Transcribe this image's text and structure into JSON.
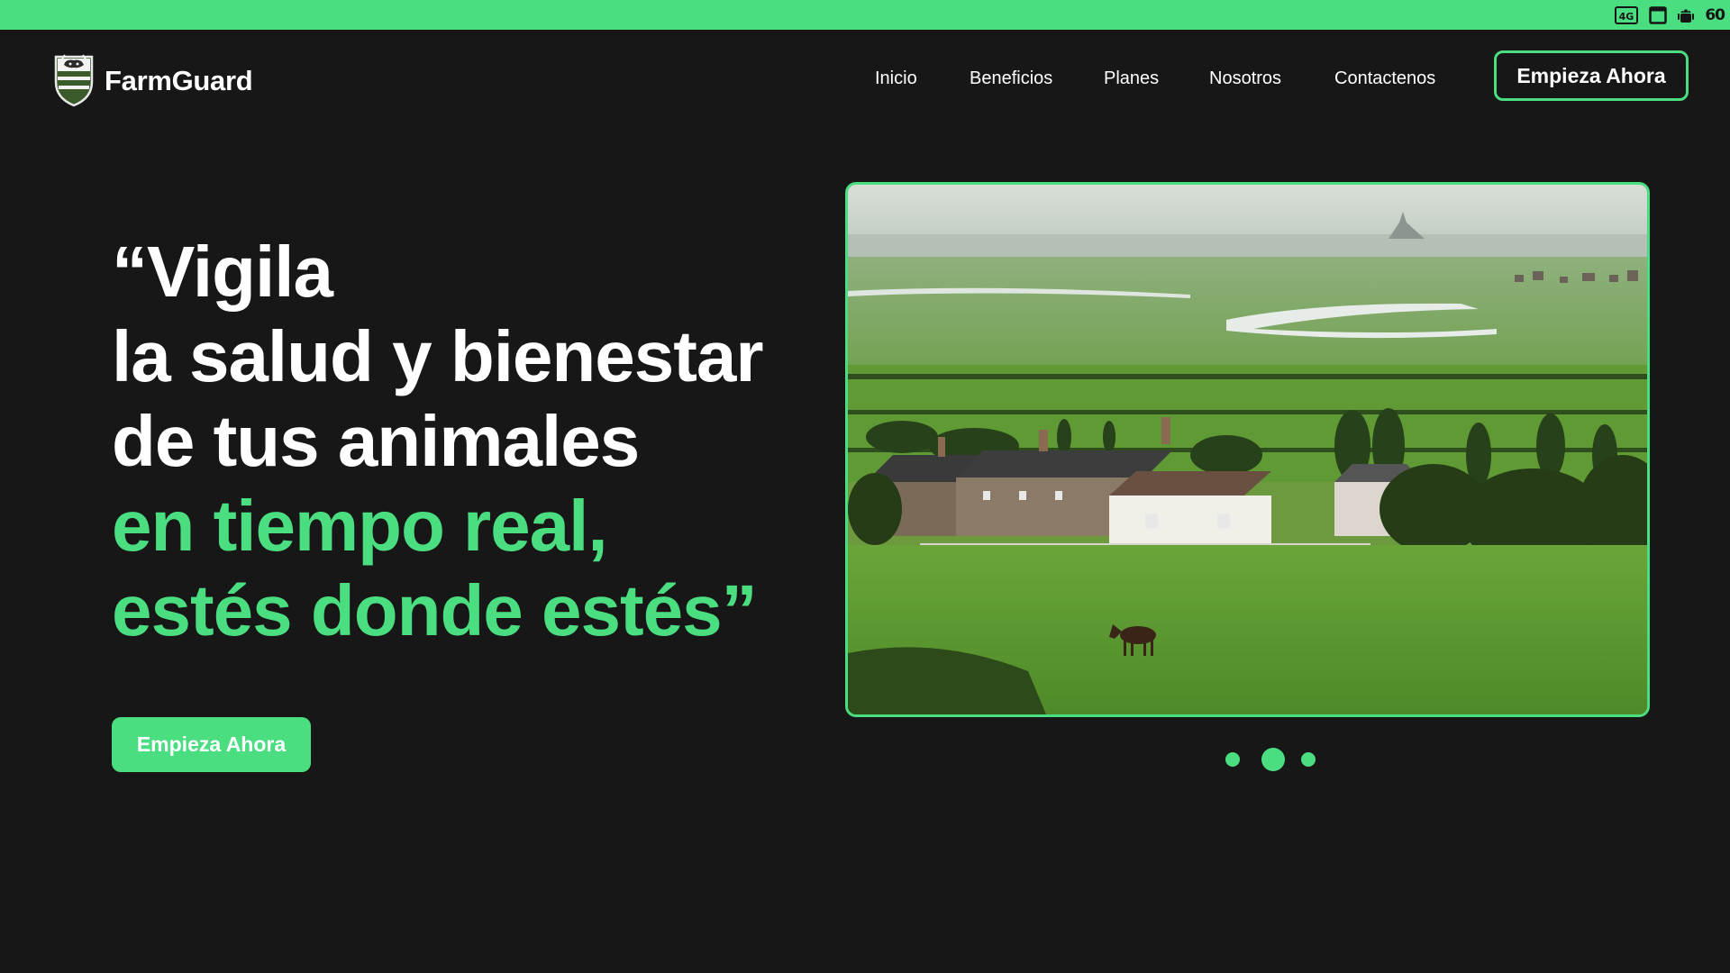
{
  "colors": {
    "accent": "#4ade80",
    "background": "#171717",
    "text": "#ffffff"
  },
  "status_bar": {
    "icons": [
      "4g-icon",
      "window-icon",
      "android-icon"
    ],
    "network_label": "4G",
    "fps": "60"
  },
  "brand": {
    "name": "FarmGuard",
    "logo_icon": "shield-logo-icon"
  },
  "nav": {
    "links": [
      "Inicio",
      "Beneficios",
      "Planes",
      "Nosotros",
      "Contactenos"
    ],
    "cta_label": "Empieza Ahora"
  },
  "hero": {
    "title_lines": [
      "“Vigila",
      "la salud y bienestar",
      "de tus animales",
      "en tiempo real,",
      "estés donde estés”"
    ],
    "cta_label": "Empieza Ahora"
  },
  "carousel": {
    "image": "countryside-farm-landscape-photo",
    "slide_count": 3,
    "active_index": 1
  }
}
